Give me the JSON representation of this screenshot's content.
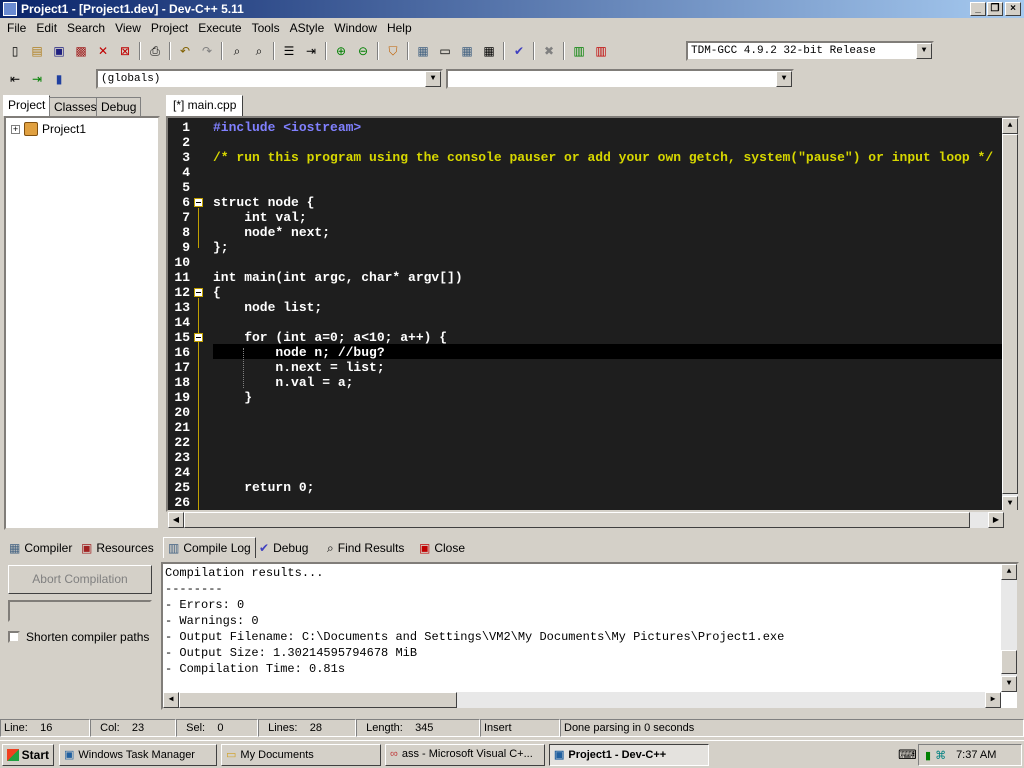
{
  "window": {
    "title": "Project1 - [Project1.dev] - Dev-C++ 5.11"
  },
  "menu": [
    "File",
    "Edit",
    "Search",
    "View",
    "Project",
    "Execute",
    "Tools",
    "AStyle",
    "Window",
    "Help"
  ],
  "toolbar": {
    "compiler_select": "TDM-GCC 4.9.2 32-bit Release",
    "scope_select": "(globals)",
    "member_select": ""
  },
  "left_tabs": [
    "Project",
    "Classes",
    "Debug"
  ],
  "project_tree": {
    "root": "Project1"
  },
  "editor": {
    "tab_label": "[*] main.cpp",
    "lines": [
      {
        "n": "1",
        "code": "#include <iostream>"
      },
      {
        "n": "2",
        "code": ""
      },
      {
        "n": "3",
        "code": "/* run this program using the console pauser or add your own getch, system(\"pause\") or input loop */"
      },
      {
        "n": "4",
        "code": ""
      },
      {
        "n": "5",
        "code": ""
      },
      {
        "n": "6",
        "code": "struct node {"
      },
      {
        "n": "7",
        "code": "    int val;"
      },
      {
        "n": "8",
        "code": "    node* next;"
      },
      {
        "n": "9",
        "code": "};"
      },
      {
        "n": "10",
        "code": ""
      },
      {
        "n": "11",
        "code": "int main(int argc, char* argv[])"
      },
      {
        "n": "12",
        "code": "{"
      },
      {
        "n": "13",
        "code": "    node list;"
      },
      {
        "n": "14",
        "code": ""
      },
      {
        "n": "15",
        "code": "    for (int a=0; a<10; a++) {"
      },
      {
        "n": "16",
        "code": "        node n; //bug?"
      },
      {
        "n": "17",
        "code": "        n.next = list;"
      },
      {
        "n": "18",
        "code": "        n.val = a;"
      },
      {
        "n": "19",
        "code": "    }"
      },
      {
        "n": "20",
        "code": ""
      },
      {
        "n": "21",
        "code": ""
      },
      {
        "n": "22",
        "code": ""
      },
      {
        "n": "23",
        "code": ""
      },
      {
        "n": "24",
        "code": ""
      },
      {
        "n": "25",
        "code": "    return 0;"
      },
      {
        "n": "26",
        "code": ""
      }
    ]
  },
  "bottom_tabs": [
    "Compiler",
    "Resources",
    "Compile Log",
    "Debug",
    "Find Results",
    "Close"
  ],
  "compile_panel": {
    "abort_button": "Abort Compilation",
    "shorten_paths_label": "Shorten compiler paths"
  },
  "compile_log": [
    "Compilation results...",
    "--------",
    "- Errors: 0",
    "- Warnings: 0",
    "- Output Filename: C:\\Documents and Settings\\VM2\\My Documents\\My Pictures\\Project1.exe",
    "- Output Size: 1.30214595794678 MiB",
    "- Compilation Time: 0.81s"
  ],
  "status": {
    "line_label": "Line:",
    "line_value": "16",
    "col_label": "Col:",
    "col_value": "23",
    "sel_label": "Sel:",
    "sel_value": "0",
    "lines_label": "Lines:",
    "lines_value": "28",
    "length_label": "Length:",
    "length_value": "345",
    "mode": "Insert",
    "message": "Done parsing in 0 seconds"
  },
  "taskbar": {
    "start": "Start",
    "tasks": [
      "Windows Task Manager",
      "My Documents",
      "ass - Microsoft Visual C+...",
      "Project1 - Dev-C++"
    ],
    "clock": "7:37 AM"
  }
}
